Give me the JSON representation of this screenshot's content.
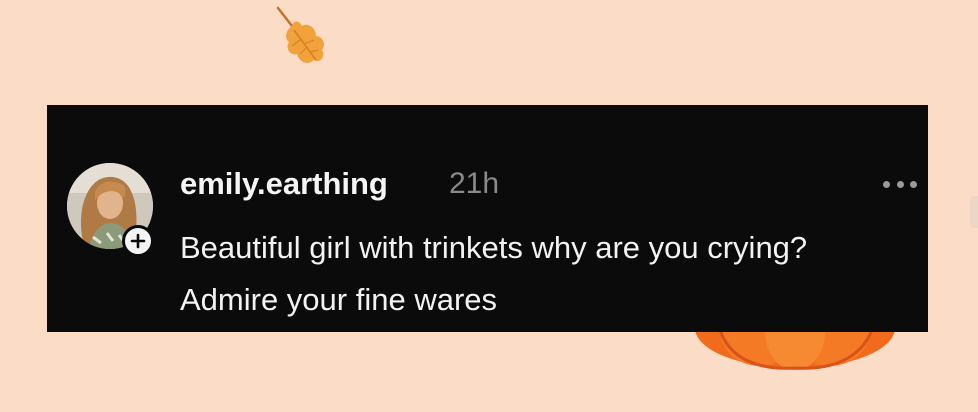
{
  "post": {
    "username": "emily.earthing",
    "timestamp": "21h",
    "text": "Beautiful girl with trinkets why are you crying? Admire your fine wares"
  },
  "icons": {
    "follow": "plus-icon",
    "more": "more-horizontal-icon",
    "leaf": "autumn-leaf-icon",
    "pumpkin": "pumpkin-icon"
  },
  "colors": {
    "background": "#fbdcc6",
    "card": "#0b0b0b",
    "text": "#f2f2f2",
    "muted": "#8a8a8a",
    "leaf": "#f2a23a",
    "pumpkin": "#f26a1b"
  }
}
